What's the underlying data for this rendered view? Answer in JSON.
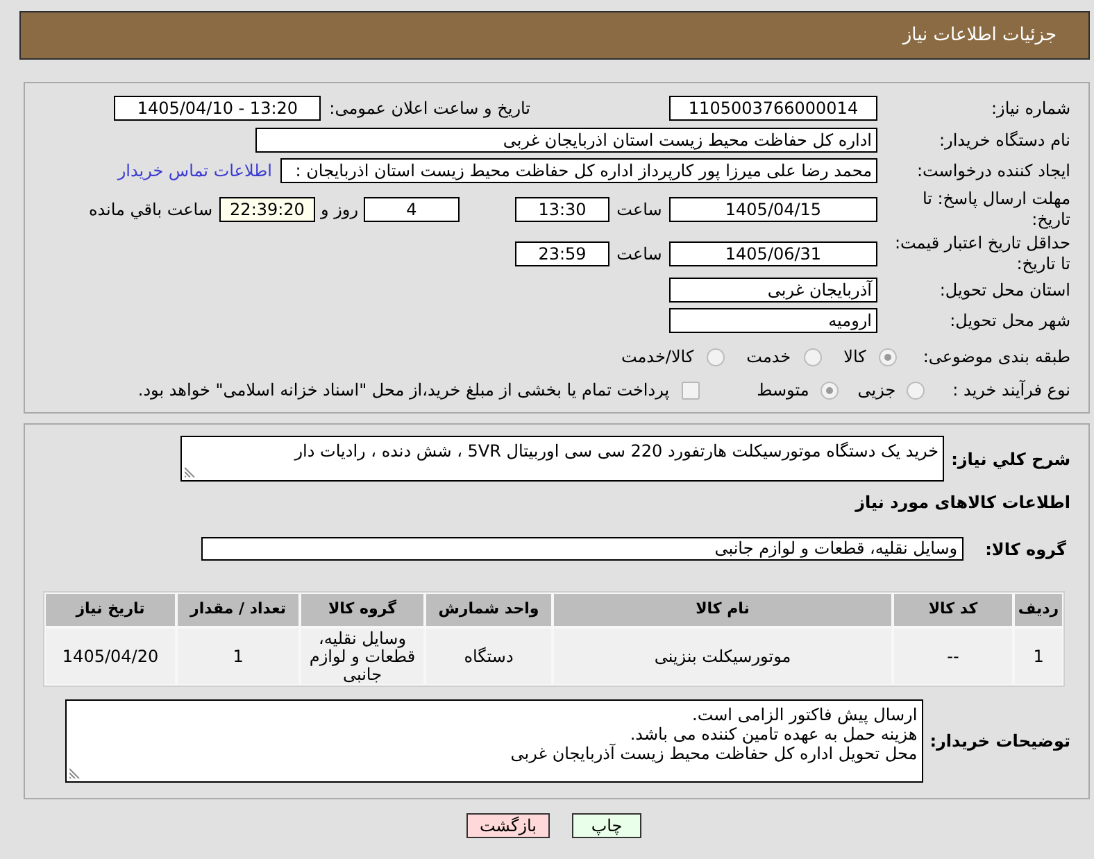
{
  "header": {
    "title": "جزئیات اطلاعات نیاز"
  },
  "details": {
    "need_number": {
      "label": "شماره نیاز:",
      "value": "1105003766000014"
    },
    "announcement": {
      "label": "تاریخ و ساعت اعلان عمومی:",
      "value": "1405/04/10 - 13:20"
    },
    "buyer_org": {
      "label": "نام دستگاه خریدار:",
      "value": "اداره کل حفاظت محیط زیست استان اذربایجان غربی"
    },
    "requester": {
      "label": "ایجاد کننده درخواست:",
      "value": "محمد رضا علی میرزا پور کارپرداز اداره کل حفاظت محیط زیست استان اذربایجان :",
      "link": "اطلاعات تماس خریدار"
    },
    "reply_deadline": {
      "label": "مهلت ارسال پاسخ: تا تاریخ:",
      "date": "1405/04/15",
      "time_label": "ساعت",
      "time": "13:30",
      "days": "4",
      "days_label": "روز و",
      "remaining": "22:39:20",
      "remaining_label": "ساعت باقي مانده"
    },
    "price_validity": {
      "label": "حداقل تاریخ اعتبار قیمت: تا تاریخ:",
      "date": "1405/06/31",
      "time_label": "ساعت",
      "time": "23:59"
    },
    "delivery_province": {
      "label": "استان محل تحویل:",
      "value": "آذربایجان غربی"
    },
    "delivery_city": {
      "label": "شهر محل تحویل:",
      "value": "ارومیه"
    },
    "subject_category": {
      "label": "طبقه بندی موضوعی:",
      "options": [
        {
          "label": "کالا",
          "selected": true
        },
        {
          "label": "خدمت",
          "selected": false
        },
        {
          "label": "کالا/خدمت",
          "selected": false
        }
      ]
    },
    "purchase_process": {
      "label": "نوع فرآیند خرید :",
      "options": [
        {
          "label": "جزیی",
          "selected": false
        },
        {
          "label": "متوسط",
          "selected": true
        }
      ],
      "treasury_payment": {
        "label": "پرداخت تمام یا بخشی از مبلغ خرید،از محل \"اسناد خزانه اسلامی\" خواهد بود.",
        "checked": false
      }
    }
  },
  "need": {
    "description_label": "شرح کلي نیاز:",
    "description": "خرید یک دستگاه موتورسیکلت هارتفورد 220 سی سی اوربیتال 5VR ،  شش دنده ، رادیات دار",
    "goods_heading": "اطلاعات کالاهای مورد نیاز",
    "group_label": "گروه کالا:",
    "group": "وسایل نقلیه، قطعات و لوازم جانبی",
    "table": {
      "columns": [
        "ردیف",
        "کد کالا",
        "نام کالا",
        "واحد شمارش",
        "گروه کالا",
        "تعداد / مقدار",
        "تاریخ نیاز"
      ],
      "rows": [
        [
          "1",
          "--",
          "موتورسیکلت بنزینی",
          "دستگاه",
          "وسایل نقلیه، قطعات و لوازم جانبی",
          "1",
          "1405/04/20"
        ]
      ]
    },
    "buyer_notes_label": "توضیحات خریدار:",
    "buyer_notes": "ارسال پیش فاکتور الزامی است.\nهزینه حمل به عهده تامین کننده می باشد.\nمحل تحویل اداره کل حفاظت محیط زیست آذربایجان غربی"
  },
  "buttons": [
    {
      "label": "چاپ",
      "kind": "print"
    },
    {
      "label": "بازگشت",
      "kind": "back"
    }
  ]
}
